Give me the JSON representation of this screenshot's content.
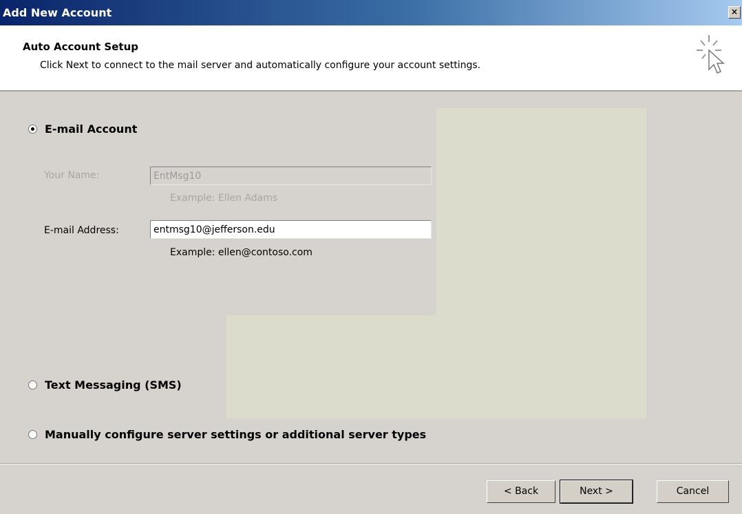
{
  "window": {
    "title": "Add New Account",
    "close_glyph": "×"
  },
  "header": {
    "title": "Auto Account Setup",
    "subtitle": "Click Next to connect to the mail server and automatically configure your account settings.",
    "icon": "wizard-cursor-icon"
  },
  "options": {
    "email_account": {
      "label": "E-mail Account",
      "selected": true
    },
    "text_messaging": {
      "label": "Text Messaging (SMS)",
      "selected": false
    },
    "manual_config": {
      "label": "Manually configure server settings or additional server types",
      "selected": false
    }
  },
  "form": {
    "your_name": {
      "label": "Your Name:",
      "value": "EntMsg10",
      "example": "Example: Ellen Adams",
      "disabled": true
    },
    "email_address": {
      "label": "E-mail Address:",
      "value": "entmsg10@jefferson.edu",
      "example": "Example: ellen@contoso.com"
    }
  },
  "buttons": {
    "back": "< Back",
    "next": "Next >",
    "cancel": "Cancel"
  }
}
